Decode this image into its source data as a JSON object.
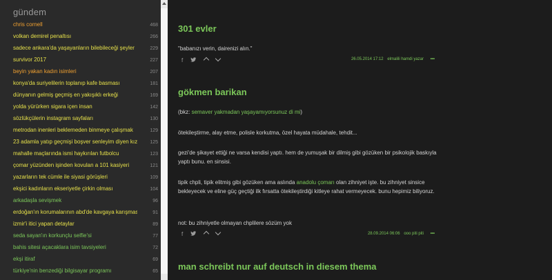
{
  "sidebar": {
    "title": "gündem",
    "topics": [
      {
        "title": "chris cornell",
        "count": "468",
        "color": "orange"
      },
      {
        "title": "volkan demirel penaltısı",
        "count": "266",
        "color": "yellow"
      },
      {
        "title": "sadece ankara'da yaşayanların bilebileceği şeyler",
        "count": "229",
        "color": "yellow"
      },
      {
        "title": "survivor 2017",
        "count": "227",
        "color": "yellow"
      },
      {
        "title": "beyin yakan kadın isimleri",
        "count": "207",
        "color": "orange"
      },
      {
        "title": "konya'da suriyelilerin toplanıp kafe basması",
        "count": "181",
        "color": "yellow"
      },
      {
        "title": "dünyanın gelmiş geçmiş en yakışıklı erkeği",
        "count": "169",
        "color": "yellow"
      },
      {
        "title": "yolda yürürken sigara içen insan",
        "count": "142",
        "color": "yellow"
      },
      {
        "title": "sözlükçülerin instagram sayfaları",
        "count": "130",
        "color": "yellow"
      },
      {
        "title": "metrodan inenleri beklemeden binmeye çalışmak",
        "count": "129",
        "color": "yellow"
      },
      {
        "title": "23 adamla yatıp geçmişi boşver senleyim diyen kız",
        "count": "125",
        "color": "yellow"
      },
      {
        "title": "mahalle maçlarında ismi haykırılan futbolcu",
        "count": "123",
        "color": "yellow"
      },
      {
        "title": "çomar yüzünden işinden kovulan a 101 kasiyeri",
        "count": "121",
        "color": "yellow"
      },
      {
        "title": "yazarların tek cümle ile siyasi görüşleri",
        "count": "109",
        "color": "yellow"
      },
      {
        "title": "ekşici kadınların ekseriyetle çirkin olması",
        "count": "104",
        "color": "yellow"
      },
      {
        "title": "arkadaşla sevişmek",
        "count": "96",
        "color": "green"
      },
      {
        "title": "erdoğan'ın korumalarının abd'de kavgaya karışması",
        "count": "91",
        "color": "yellow"
      },
      {
        "title": "izmir'i itici yapan detaylar",
        "count": "89",
        "color": "yellow"
      },
      {
        "title": "seda sayan'ın korkunçlu selfie'si",
        "count": "77",
        "color": "green"
      },
      {
        "title": "bahis sitesi açacaklara isim tavsiyeleri",
        "count": "72",
        "color": "green"
      },
      {
        "title": "ekşi itiraf",
        "count": "69",
        "color": "green"
      },
      {
        "title": "türkiye'nin benzediği bilgisayar programı",
        "count": "65",
        "color": "green"
      }
    ]
  },
  "entries": [
    {
      "title": "301 evler",
      "paragraphs": [
        "\"babanızı verin, dairenizi alın.\""
      ],
      "date": "26.05.2014 17:12",
      "author": "elmalili hamdi yazar",
      "dots": "•••"
    },
    {
      "title": "gökmen barikan",
      "bkz_prefix": "(bkz: ",
      "bkz_link": "semaver yakmadan yaşayamıyorsunuz di mi",
      "bkz_suffix": ")",
      "p1": "ötekileştirme, alay etme, polisle korkutma, özel hayata müdahale, tehdit...",
      "p2": "gezi'de şikayet ettiği ne varsa kendisi yaptı. hem de yumuşak bir dilmiş gibi gözüken bir psikolojik baskıyla yaptı bunu. en sinsisi.",
      "p3_a": "tipik chpli, tipik elitmiş gibi gözüken ama aslında ",
      "p3_link": "anadolu çomarı",
      "p3_b": " olan zihniyet işte. bu zihniyet sinsice bekleyecek ve eline güç geçtiği ilk fırsatta ötekileştirdiği kitleye rahat vermeyecek. bunu hepimiz biliyoruz.",
      "p4": "not: bu zihniyetle olmayan chplilere sözüm yok",
      "date": "28.09.2014 06:06",
      "author": "ooo piti piti",
      "dots": "•••"
    },
    {
      "title": "man schreibt nur auf deutsch in diesem thema"
    }
  ],
  "colors": {
    "green": "#7cc85a",
    "yellow": "#e6e04a",
    "orange": "#f0a030"
  },
  "icons": {
    "share_fb": "f",
    "share_tw": "twitter-icon"
  }
}
